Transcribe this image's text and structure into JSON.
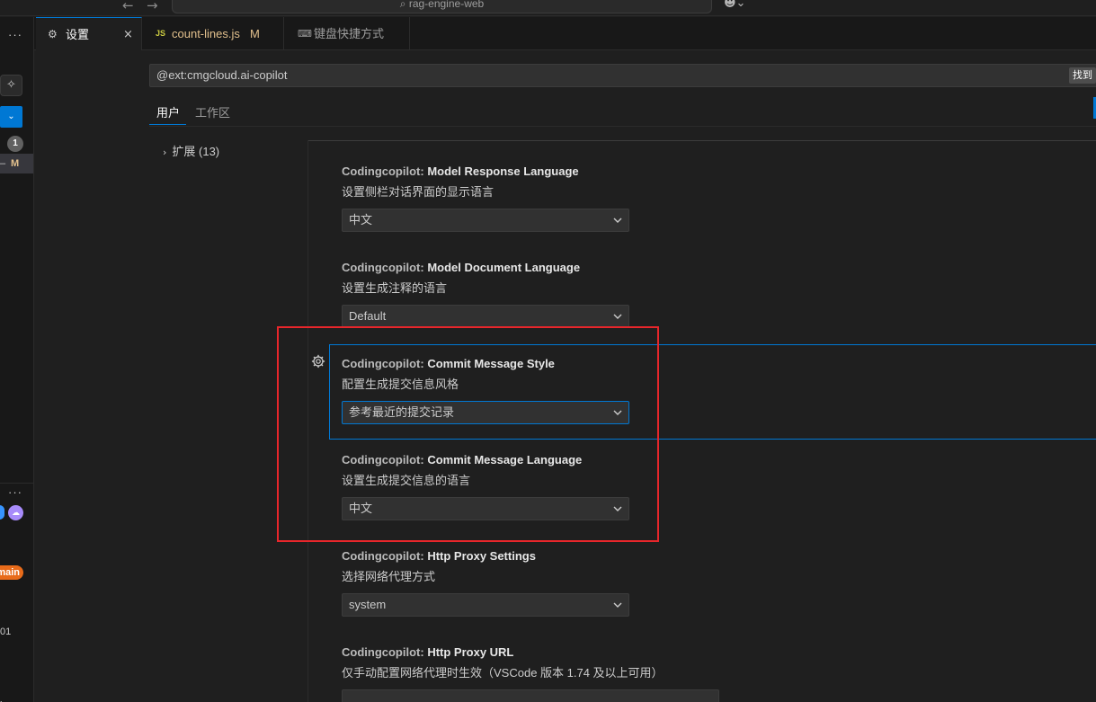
{
  "titlebar": {
    "back_arrow": "←",
    "forward_arrow": "→",
    "search_text": "⌕ rag-engine-web",
    "copilot_icon": "☻⌄"
  },
  "left_strip": {
    "dots_top": "···",
    "sparkle": "✧",
    "blue_button": "⌄",
    "badge": "1",
    "active_row_dash": "–",
    "active_row_status": "M",
    "dots_bottom": "···",
    "branch": "main",
    "number": "01",
    "mark": "l"
  },
  "tabs": [
    {
      "icon": "⚙",
      "label": "设置",
      "close": "×"
    },
    {
      "icon": "JS",
      "label": "count-lines.js",
      "status": "M"
    },
    {
      "icon": "⌨",
      "label": "键盘快捷方式"
    }
  ],
  "settings": {
    "search_value": "@ext:cmgcloud.ai-copilot",
    "found_text": "找到",
    "scope_tabs": [
      "用户",
      "工作区"
    ],
    "tree_item": "扩展 (13)",
    "chevron_right": "›",
    "items": [
      {
        "category": "Codingcopilot: ",
        "name": "Model Response Language",
        "description": "设置侧栏对话界面的显示语言",
        "value": "中文"
      },
      {
        "category": "Codingcopilot: ",
        "name": "Model Document Language",
        "description": "设置生成注释的语言",
        "value": "Default"
      },
      {
        "category": "Codingcopilot: ",
        "name": "Commit Message Style",
        "description": "配置生成提交信息风格",
        "value": "参考最近的提交记录"
      },
      {
        "category": "Codingcopilot: ",
        "name": "Commit Message Language",
        "description": "设置生成提交信息的语言",
        "value": "中文"
      },
      {
        "category": "Codingcopilot: ",
        "name": "Http Proxy Settings",
        "description": "选择网络代理方式",
        "value": "system"
      },
      {
        "category": "Codingcopilot: ",
        "name": "Http Proxy URL",
        "description": "仅手动配置网络代理时生效（VSCode 版本 1.74 及以上可用）"
      }
    ]
  },
  "colors": {
    "accent": "#0078d4",
    "annotation": "#e8262b",
    "modified": "#e2c08d"
  }
}
